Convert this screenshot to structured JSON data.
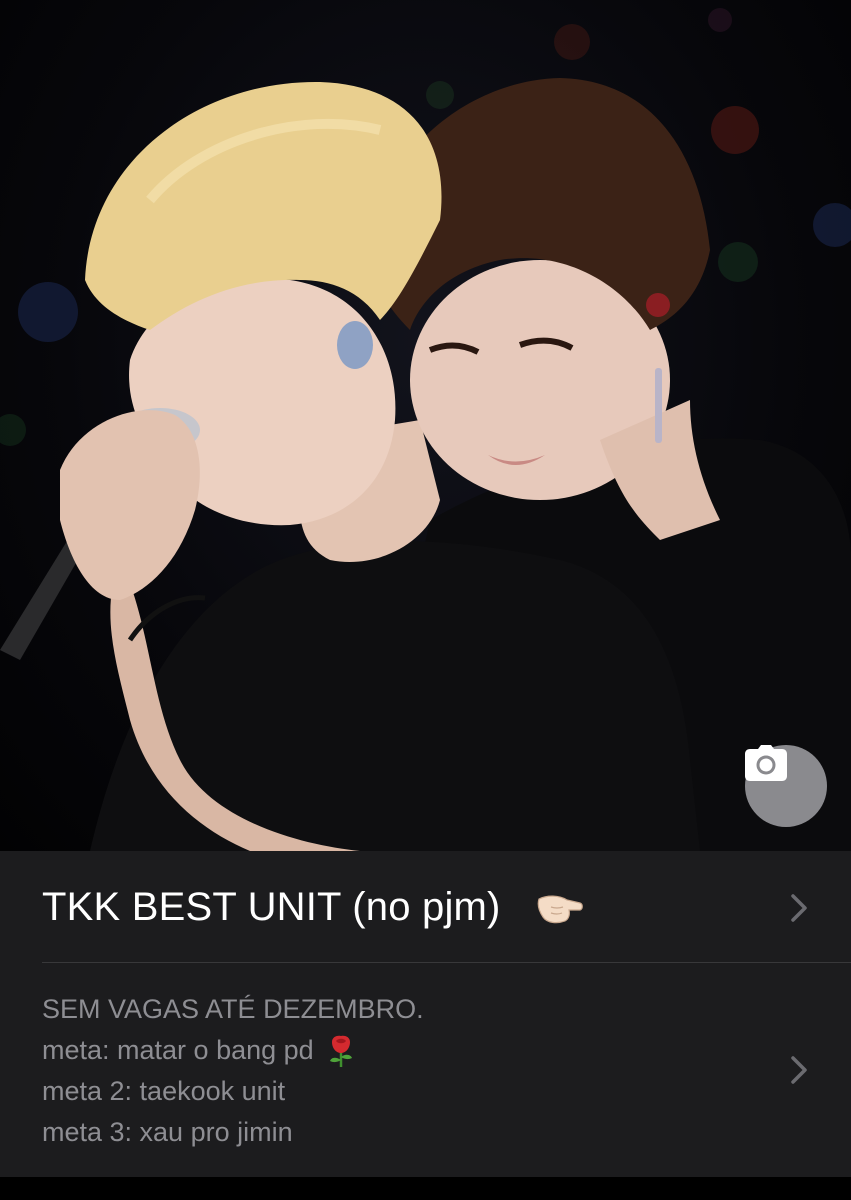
{
  "photo": {
    "camera_icon": "camera-icon"
  },
  "card": {
    "title": "TKK BEST UNIT (no pjm)",
    "title_emoji_icon": "pointing-hand-icon",
    "chevron_icon": "chevron-right-icon",
    "description_lines": [
      "SEM VAGAS ATÉ DEZEMBRO.",
      "meta: matar o bang pd",
      "meta 2: taekook unit",
      "meta 3: xau pro jimin"
    ],
    "description_emoji_icon": "rose-icon"
  },
  "colors": {
    "background": "#000000",
    "card": "#1c1c1e",
    "title": "#ffffff",
    "description": "#8e8e93",
    "divider": "#38383a",
    "camera_button": "#8a8a8e"
  }
}
